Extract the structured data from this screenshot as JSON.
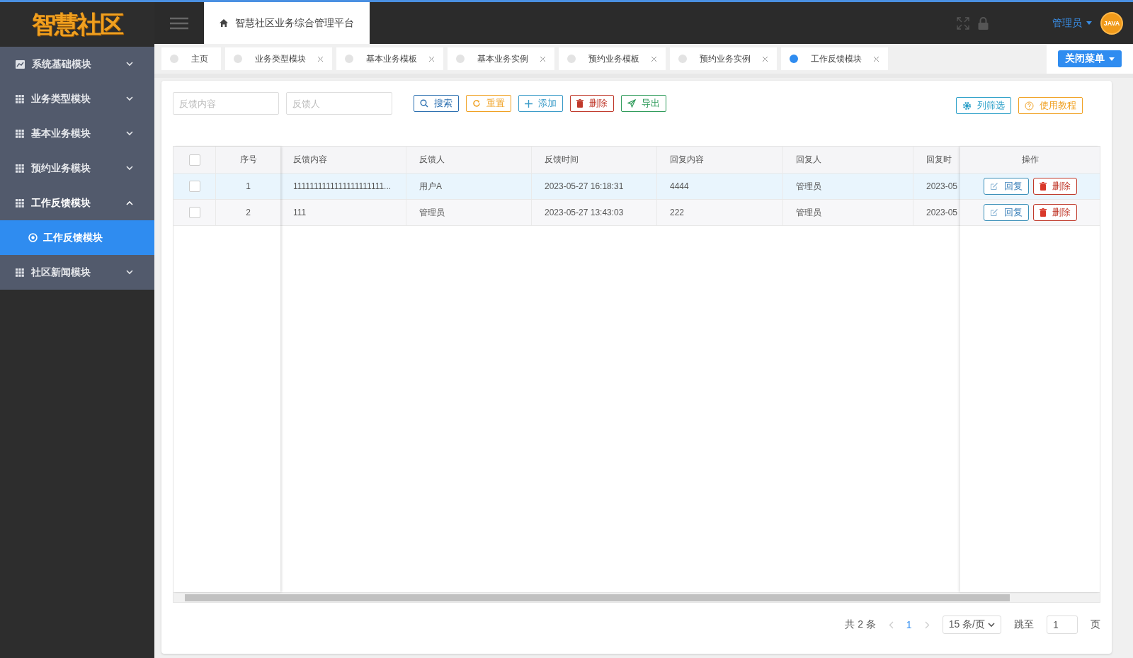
{
  "logo": {
    "text": "智慧社区"
  },
  "header": {
    "title": "智慧社区业务综合管理平台",
    "user": "管理员",
    "avatar_text": "JAVA"
  },
  "sidebar": {
    "items": [
      {
        "label": "系统基础模块",
        "expanded": false
      },
      {
        "label": "业务类型模块",
        "expanded": false
      },
      {
        "label": "基本业务模块",
        "expanded": false
      },
      {
        "label": "预约业务模块",
        "expanded": false
      },
      {
        "label": "工作反馈模块",
        "expanded": true,
        "children": [
          {
            "label": "工作反馈模块",
            "selected": true
          }
        ]
      },
      {
        "label": "社区新闻模块",
        "expanded": false
      }
    ]
  },
  "tabs": [
    {
      "label": "主页",
      "closable": false,
      "selected": false
    },
    {
      "label": "业务类型模块",
      "closable": true,
      "selected": false
    },
    {
      "label": "基本业务模板",
      "closable": true,
      "selected": false
    },
    {
      "label": "基本业务实例",
      "closable": true,
      "selected": false
    },
    {
      "label": "预约业务模板",
      "closable": true,
      "selected": false
    },
    {
      "label": "预约业务实例",
      "closable": true,
      "selected": false
    },
    {
      "label": "工作反馈模块",
      "closable": true,
      "selected": true
    }
  ],
  "close_menu_button": "关闭菜单",
  "filters": [
    {
      "placeholder": "反馈内容"
    },
    {
      "placeholder": "反馈人"
    }
  ],
  "toolbar": [
    {
      "label": "搜索",
      "kind": "search"
    },
    {
      "label": "重置",
      "kind": "reset"
    },
    {
      "label": "添加",
      "kind": "add"
    },
    {
      "label": "删除",
      "kind": "delete"
    },
    {
      "label": "导出",
      "kind": "export"
    }
  ],
  "toolbar_right": [
    {
      "label": "列筛选",
      "kind": "columns"
    },
    {
      "label": "使用教程",
      "kind": "help"
    }
  ],
  "table": {
    "all_checked": false,
    "index_header": "序号",
    "action_header": "操作",
    "columns": [
      "反馈内容",
      "反馈人",
      "反馈时间",
      "回复内容",
      "回复人",
      "回复时"
    ],
    "rows": [
      {
        "index": "1",
        "checked": false,
        "highlighted": true,
        "cells": [
          "1111111111111111111111...",
          "用户A",
          "2023-05-27 16:18:31",
          "4444",
          "管理员",
          "2023-05"
        ],
        "actions": [
          "回复",
          "删除"
        ]
      },
      {
        "index": "2",
        "checked": false,
        "highlighted": false,
        "cells": [
          "111",
          "管理员",
          "2023-05-27 13:43:03",
          "222",
          "管理员",
          "2023-05"
        ],
        "actions": [
          "回复",
          "删除"
        ]
      }
    ]
  },
  "pagination": {
    "total": "共 2 条",
    "current_page": "1",
    "page_size": "15 条/页",
    "goto_label": "跳至",
    "goto_value": "1",
    "page_suffix": "页"
  }
}
